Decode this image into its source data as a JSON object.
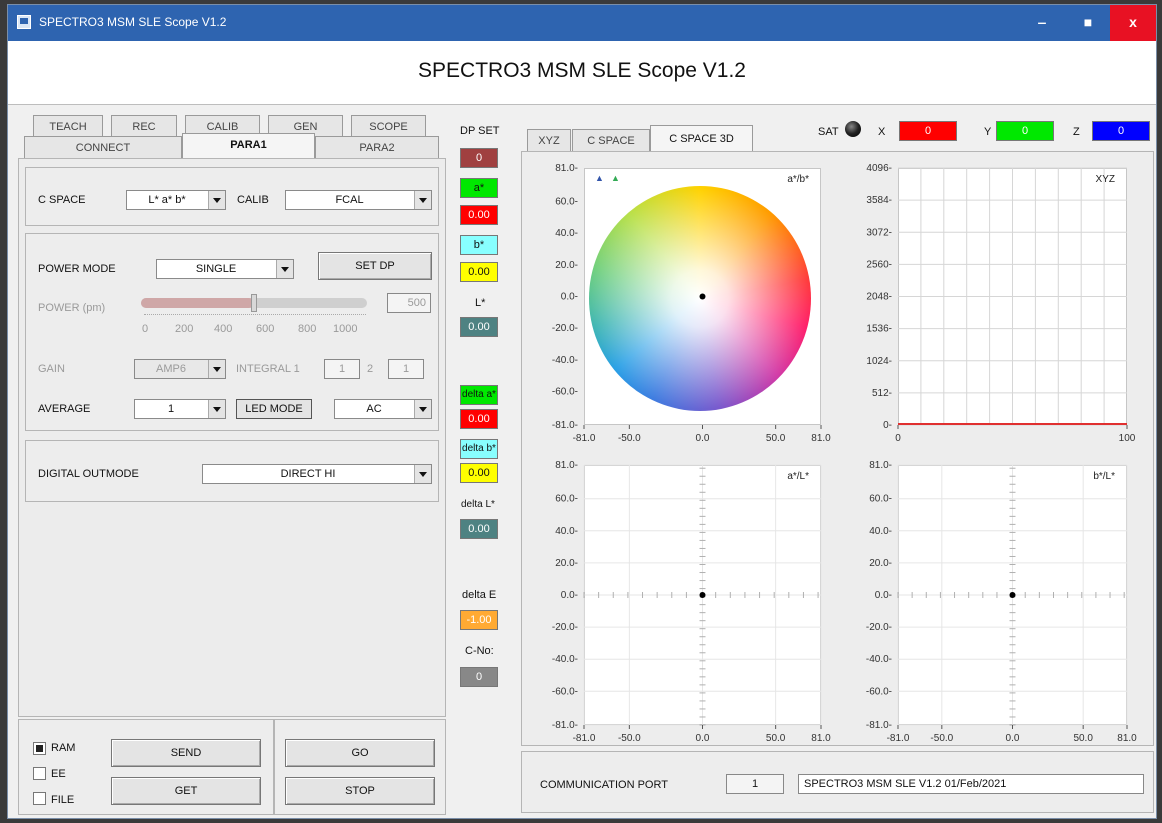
{
  "window": {
    "title": "SPECTRO3 MSM SLE Scope V1.2",
    "minimize": "‒",
    "maximize": "■",
    "close": "x"
  },
  "app_title": "SPECTRO3 MSM SLE Scope V1.2",
  "tabs_top": [
    "TEACH",
    "REC",
    "CALIB",
    "GEN",
    "SCOPE"
  ],
  "tabs_bottom": [
    "CONNECT",
    "PARA1",
    "PARA2"
  ],
  "cspace": {
    "label": "C SPACE",
    "value": "L* a* b*",
    "calib_label": "CALIB",
    "calib_value": "FCAL"
  },
  "power": {
    "mode_label": "POWER MODE",
    "mode_value": "SINGLE",
    "set_dp": "SET DP",
    "power_label": "POWER (pm)",
    "power_value": "500",
    "power_level": 500,
    "scale": [
      "0",
      "200",
      "400",
      "600",
      "800",
      "1000"
    ],
    "gain_label": "GAIN",
    "gain_value": "AMP6",
    "integral_label": "INTEGRAL 1",
    "integral_1": "1",
    "integral_sep": "2",
    "integral_2": "1",
    "average_label": "AVERAGE",
    "average_value": "1",
    "led_mode_label": "LED MODE",
    "led_mode_value": "AC"
  },
  "digital": {
    "label": "DIGITAL OUTMODE",
    "value": "DIRECT HI"
  },
  "mem": {
    "ram": "RAM",
    "ee": "EE",
    "file": "FILE",
    "send": "SEND",
    "get": "GET",
    "go": "GO",
    "stop": "STOP"
  },
  "dp": {
    "header": "DP SET",
    "dp_value": "0",
    "a_label": "a*",
    "a_value": "0.00",
    "b_label": "b*",
    "b_value": "0.00",
    "l_label": "L*",
    "l_value": "0.00",
    "da_label": "delta a*",
    "da_value": "0.00",
    "db_label": "delta b*",
    "db_value": "0.00",
    "dl_label": "delta L*",
    "dl_value": "0.00",
    "de_label": "delta E",
    "de_value": "-1.00",
    "cno_label": "C-No:",
    "cno_value": "0"
  },
  "right_tabs": [
    "XYZ",
    "C SPACE",
    "C SPACE 3D"
  ],
  "sat": {
    "label": "SAT",
    "x_label": "X",
    "x_value": "0",
    "y_label": "Y",
    "y_value": "0",
    "z_label": "Z",
    "z_value": "0"
  },
  "comm": {
    "label": "COMMUNICATION PORT",
    "port": "1",
    "info": "SPECTRO3 MSM SLE V1.2    01/Feb/2021"
  },
  "colors": {
    "red": "#ff0000",
    "green": "#00e800",
    "blue": "#0000ff",
    "yellow": "#ffff00",
    "cyan": "#88ffff",
    "teal": "#4e8282",
    "orange": "#ffaa33",
    "darkred": "#a04040",
    "gray": "#888888"
  },
  "chart_data": [
    {
      "type": "scatter",
      "title": "a*/b*",
      "x_ticks": [
        "-81.0",
        "-50.0",
        "0.0",
        "50.0",
        "81.0"
      ],
      "y_ticks": [
        "81.0",
        "60.0",
        "40.0",
        "20.0",
        "0.0",
        "-20.0",
        "-40.0",
        "-60.0",
        "-81.0"
      ],
      "xlim": [
        -81,
        81
      ],
      "ylim": [
        -81,
        81
      ],
      "points": [
        {
          "x": 0,
          "y": 0
        }
      ]
    },
    {
      "type": "line",
      "title": "XYZ",
      "x_ticks": [
        "0",
        "100"
      ],
      "y_ticks": [
        "4096",
        "3584",
        "3072",
        "2560",
        "2048",
        "1536",
        "1024",
        "512",
        "0"
      ],
      "xlim": [
        0,
        100
      ],
      "ylim": [
        0,
        4096
      ],
      "series": [
        {
          "values": [
            0,
            0
          ]
        }
      ]
    },
    {
      "type": "scatter",
      "title": "a*/L*",
      "x_ticks": [
        "-81.0",
        "-50.0",
        "0.0",
        "50.0",
        "81.0"
      ],
      "y_ticks": [
        "81.0",
        "60.0",
        "40.0",
        "20.0",
        "0.0",
        "-20.0",
        "-40.0",
        "-60.0",
        "-81.0"
      ],
      "xlim": [
        -81,
        81
      ],
      "ylim": [
        -81,
        81
      ],
      "points": [
        {
          "x": 0,
          "y": 0
        }
      ]
    },
    {
      "type": "scatter",
      "title": "b*/L*",
      "x_ticks": [
        "-81.0",
        "-50.0",
        "0.0",
        "50.0",
        "81.0"
      ],
      "y_ticks": [
        "81.0",
        "60.0",
        "40.0",
        "20.0",
        "0.0",
        "-20.0",
        "-40.0",
        "-60.0",
        "-81.0"
      ],
      "xlim": [
        -81,
        81
      ],
      "ylim": [
        -81,
        81
      ],
      "points": [
        {
          "x": 0,
          "y": 0
        }
      ]
    }
  ]
}
